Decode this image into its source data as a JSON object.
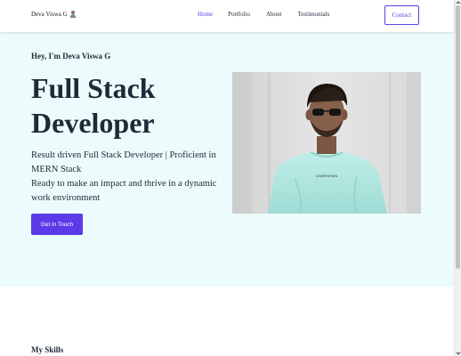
{
  "header": {
    "brand": "Deva Viswa G",
    "brand_icon": "person-emoji-icon",
    "nav": [
      {
        "label": "Home",
        "active": true
      },
      {
        "label": "Portfolio",
        "active": false
      },
      {
        "label": "About",
        "active": false
      },
      {
        "label": "Testimonials",
        "active": false
      }
    ],
    "contact_label": "Contact"
  },
  "hero": {
    "greeting": "Hey, I'm Deva Viswa G",
    "title": "Full Stack Developer",
    "description_line1": "Result driven Full Stack Developer | Proficient in MERN Stack",
    "description_line2": "Ready to make an impact and thrive in a dynamic work environment",
    "cta_label": "Get in Touch",
    "portrait_print": "LOWERDOWN"
  },
  "skills": {
    "title": "My Skills"
  },
  "colors": {
    "accent": "#4f46e5",
    "cta_bg": "#5b3be8",
    "hero_bg": "#ecfbfb",
    "text": "#1f2937"
  }
}
